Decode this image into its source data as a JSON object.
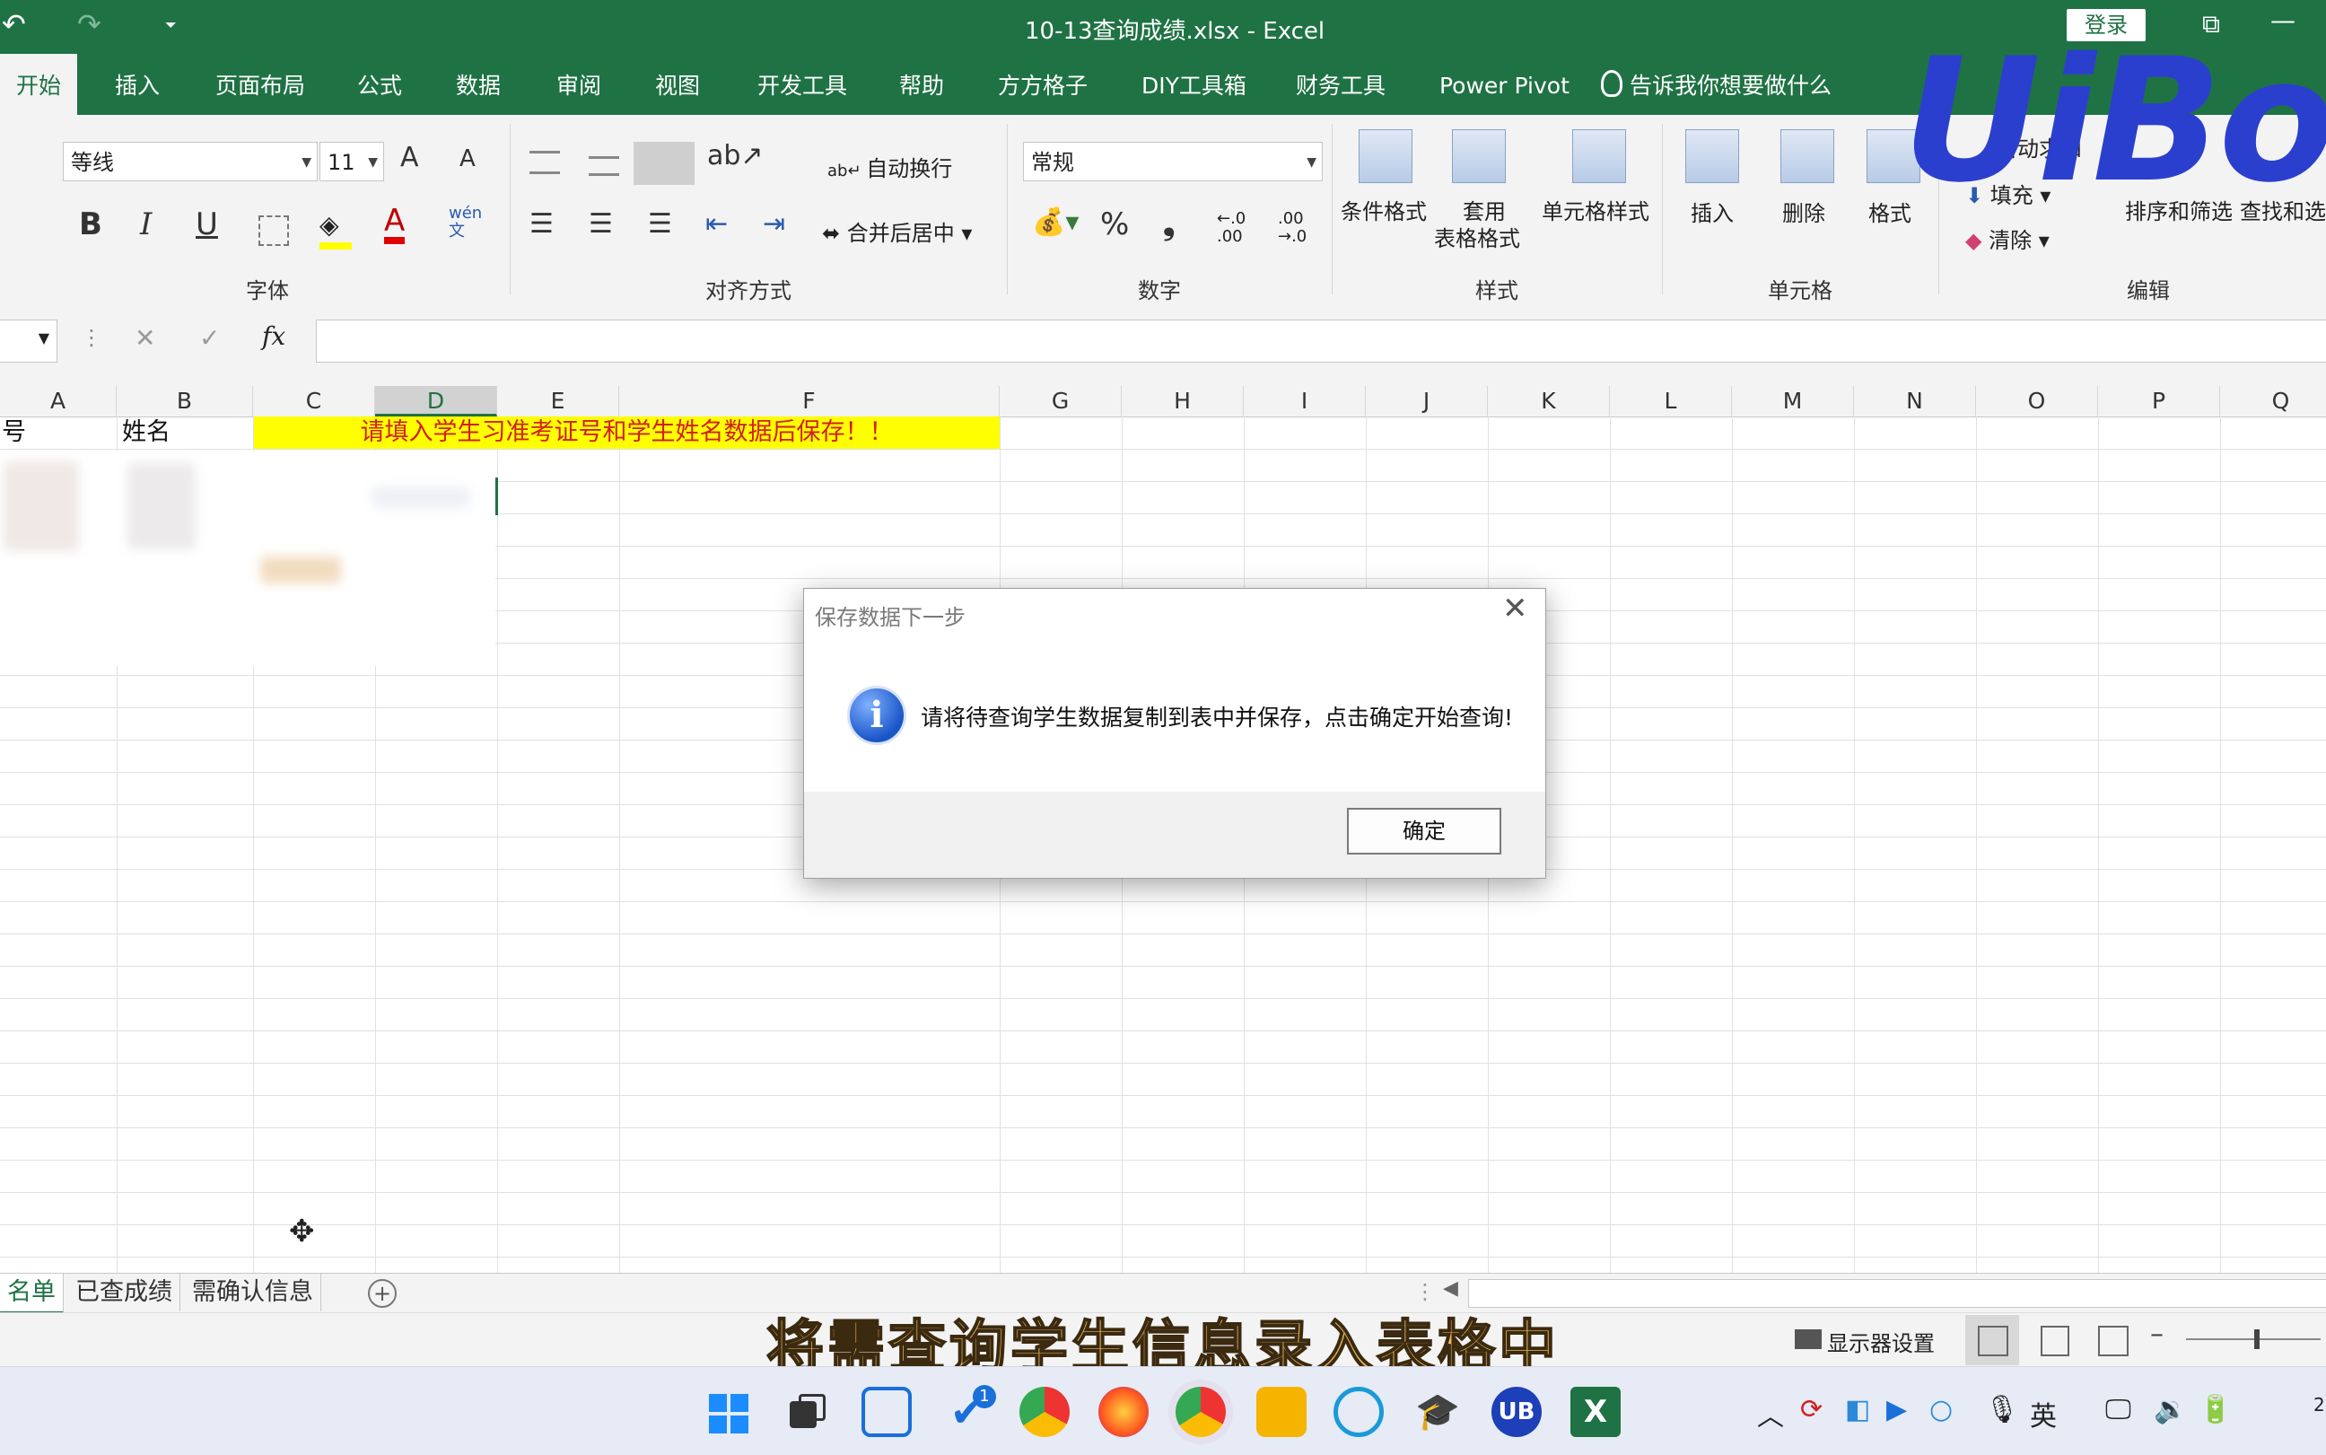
{
  "window": {
    "title": "10-13查询成绩.xlsx  -  Excel",
    "login": "登录",
    "undo_glyph": "↶",
    "redo_glyph": "↷",
    "qat_glyph": "⏷",
    "restore_glyph": "⧉",
    "min_glyph": "—"
  },
  "ribbon_tabs": [
    "开始",
    "插入",
    "页面布局",
    "公式",
    "数据",
    "审阅",
    "视图",
    "开发工具",
    "帮助",
    "方方格子",
    "DIY工具箱",
    "财务工具",
    "Power Pivot",
    "告诉我你想要做什么"
  ],
  "ribbon": {
    "font": {
      "name": "等线",
      "size": "11",
      "grow": "A",
      "shrink": "A",
      "bold": "B",
      "italic": "I",
      "underline": "U",
      "wen": "wén\n文",
      "group_label": "字体"
    },
    "alignment": {
      "wrap": "自动换行",
      "merge": "合并后居中",
      "group_label": "对齐方式"
    },
    "number": {
      "format": "常规",
      "percent": "%",
      "comma": "❟",
      "inc_dec": "←.0\n.00",
      "dec_dec": ".00\n→.0",
      "group_label": "数字"
    },
    "styles": {
      "conditional": "条件格式",
      "table_a": "套用",
      "table_b": "表格格式",
      "cell_styles": "单元格样式",
      "group_label": "样式"
    },
    "cells": {
      "insert": "插入",
      "delete": "删除",
      "format": "格式",
      "group_label": "单元格"
    },
    "editing": {
      "autosum": "自动求和",
      "fill": "填充",
      "clear": "清除",
      "sort": "排序和筛选",
      "find": "查找和选",
      "group_label": "编辑"
    }
  },
  "formula_bar": {
    "fx": "fx",
    "cancel": "✕",
    "enter": "✓",
    "value": ""
  },
  "columns": [
    "A",
    "B",
    "C",
    "D",
    "E",
    "F",
    "G",
    "H",
    "I",
    "J",
    "K",
    "L",
    "M",
    "N",
    "O",
    "P",
    "Q"
  ],
  "cells": {
    "A1": "号",
    "B1": "姓名",
    "banner": "请填入学生习准考证号和学生姓名数据后保存！！"
  },
  "sheets": [
    "名单",
    "已查成绩",
    "需确认信息"
  ],
  "status": {
    "display_settings": "显示器设置"
  },
  "subtitle": "将需查询学生信息录入表格中",
  "dialog": {
    "title": "保存数据下一步",
    "message": "请将待查询学生数据复制到表中并保存，点击确定开始查询!",
    "ok": "确定",
    "info_glyph": "i",
    "close_glyph": "✕"
  },
  "watermark": "UiBot",
  "taskbar": {
    "badge": "1",
    "ub": "UB",
    "excel": "X",
    "tray_ime": "英",
    "tray_date": "2"
  },
  "colors": {
    "excel_green": "#1f7244",
    "banner_yellow": "#ffff00",
    "banner_red": "#d02020"
  }
}
